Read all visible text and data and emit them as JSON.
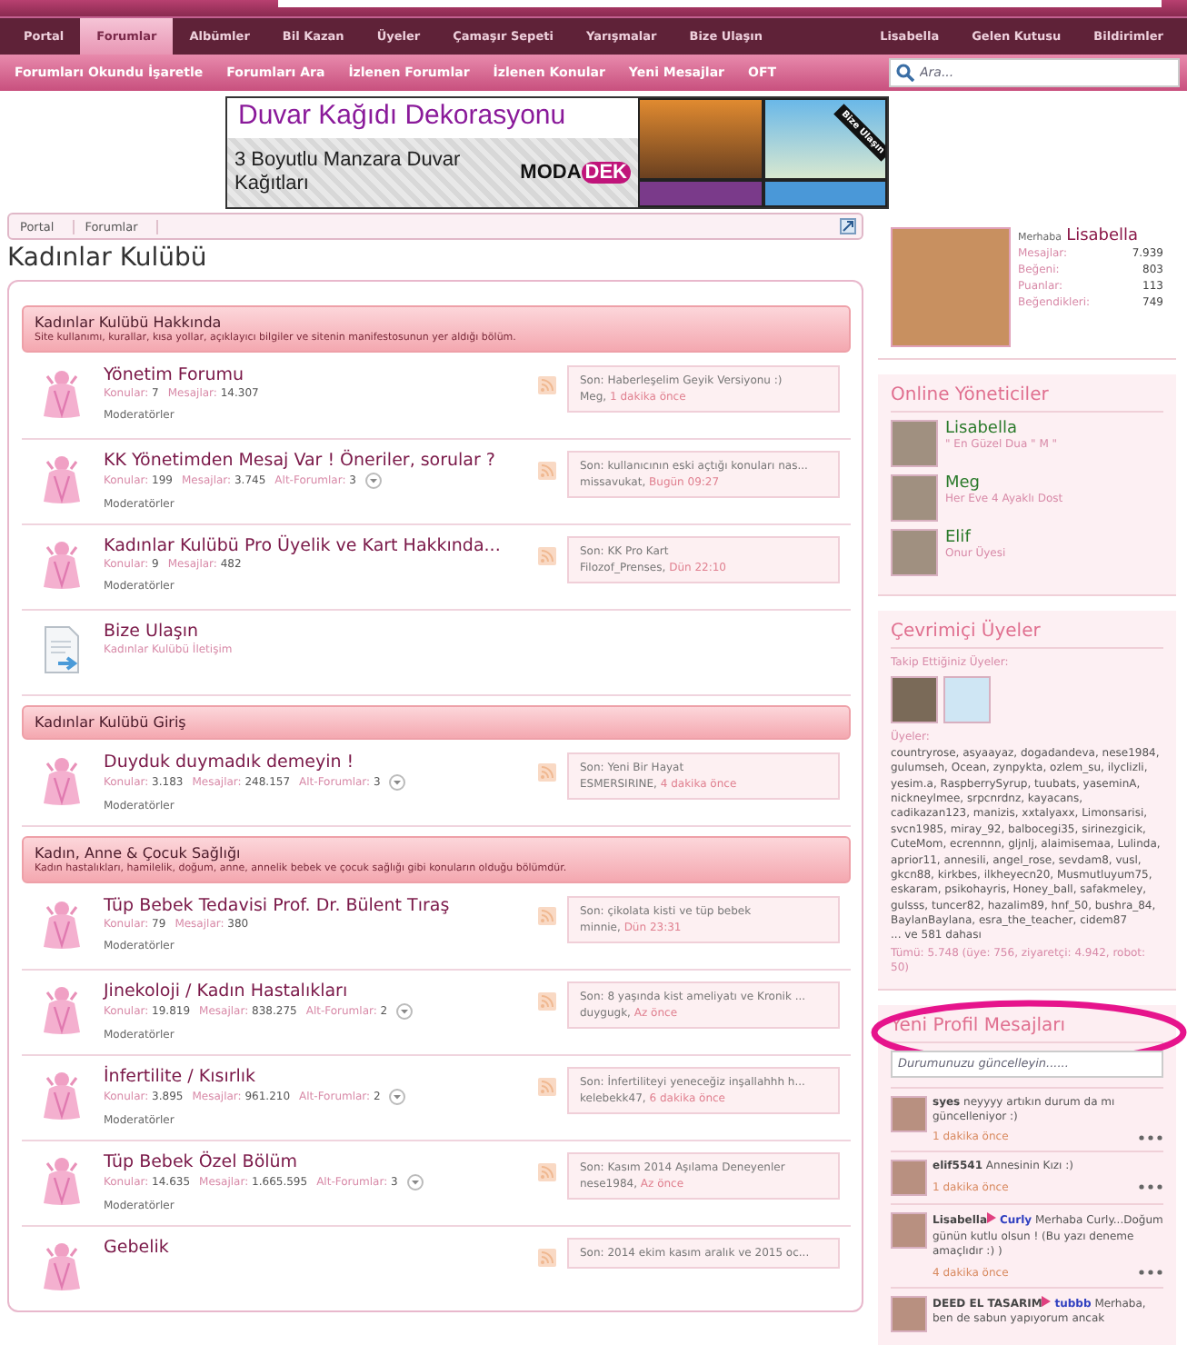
{
  "nav": {
    "tabs": [
      {
        "label": "Portal",
        "selected": false
      },
      {
        "label": "Forumlar",
        "selected": true
      },
      {
        "label": "Albümler",
        "selected": false
      },
      {
        "label": "Bil Kazan",
        "selected": false
      },
      {
        "label": "Üyeler",
        "selected": false
      },
      {
        "label": "Çamaşır Sepeti",
        "selected": false
      },
      {
        "label": "Yarışmalar",
        "selected": false
      },
      {
        "label": "Bize Ulaşın",
        "selected": false
      }
    ],
    "user_links": [
      "Lisabella",
      "Gelen Kutusu",
      "Bildirimler"
    ],
    "sub_links": [
      "Forumları Okundu İşaretle",
      "Forumları Ara",
      "İzlenen Forumlar",
      "İzlenen Konular",
      "Yeni Mesajlar",
      "OFT"
    ],
    "search": {
      "placeholder": "Ara..."
    }
  },
  "ad": {
    "headline": "Duvar Kağıdı Dekorasyonu",
    "text": "3 Boyutlu Manzara Duvar Kağıtları",
    "logo_left": "MODA",
    "logo_right": "DEK",
    "ribbon": "Bize Ulaşın"
  },
  "breadcrumb": [
    "Portal",
    "Forumlar"
  ],
  "page_title": "Kadınlar Kulübü",
  "categories": [
    {
      "title": "Kadınlar Kulübü Hakkında",
      "description": "Site kullanımı, kurallar, kısa yollar, açıklayıcı bilgiler ve sitenin manifestosunun yer aldığı bölüm.",
      "forums": [
        {
          "kind": "forum",
          "title": "Yönetim Forumu",
          "topics_label": "Konular:",
          "topics": "7",
          "posts_label": "Mesajlar:",
          "posts": "14.307",
          "moderators": "Moderatörler",
          "last_title": "Son: Haberleşelim Geyik Versiyonu :)",
          "last_user": "Meg,",
          "last_time": "1 dakika önce"
        },
        {
          "kind": "forum",
          "title": "KK Yönetimden Mesaj Var ! Öneriler, sorular ?",
          "topics_label": "Konular:",
          "topics": "199",
          "posts_label": "Mesajlar:",
          "posts": "3.745",
          "sub_label": "Alt-Forumlar:",
          "subforums": "3",
          "moderators": "Moderatörler",
          "last_title": "Son: kullanıcının eski açtığı konuları nas...",
          "last_user": "missavukat,",
          "last_time": "Bugün 09:27"
        },
        {
          "kind": "forum",
          "title": "Kadınlar Kulübü Pro Üyelik ve Kart Hakkında...",
          "topics_label": "Konular:",
          "topics": "9",
          "posts_label": "Mesajlar:",
          "posts": "482",
          "moderators": "Moderatörler",
          "last_title": "Son: KK Pro Kart",
          "last_user": "Filozof_Prenses,",
          "last_time": "Dün 22:10"
        },
        {
          "kind": "link",
          "title": "Bize Ulaşın",
          "description": "Kadınlar Kulübü İletişim"
        }
      ]
    },
    {
      "title": "Kadınlar Kulübü Giriş",
      "forums": [
        {
          "kind": "forum",
          "title": "Duyduk duymadık demeyin !",
          "topics_label": "Konular:",
          "topics": "3.183",
          "posts_label": "Mesajlar:",
          "posts": "248.157",
          "sub_label": "Alt-Forumlar:",
          "subforums": "3",
          "moderators": "Moderatörler",
          "last_title": "Son: Yeni Bir Hayat",
          "last_user": "ESMERSIRINE,",
          "last_time": "4 dakika önce"
        }
      ]
    },
    {
      "title": "Kadın, Anne & Çocuk Sağlığı",
      "description": "Kadın hastalıkları, hamilelik, doğum, anne, annelik bebek ve çocuk sağlığı gibi konuların olduğu bölümdür.",
      "forums": [
        {
          "kind": "forum",
          "title": "Tüp Bebek Tedavisi Prof. Dr. Bülent Tıraş",
          "topics_label": "Konular:",
          "topics": "79",
          "posts_label": "Mesajlar:",
          "posts": "380",
          "moderators": "Moderatörler",
          "last_title": "Son: çikolata kisti ve tüp bebek",
          "last_user": "minnie,",
          "last_time": "Dün 23:31"
        },
        {
          "kind": "forum",
          "title": "Jinekoloji / Kadın Hastalıkları",
          "topics_label": "Konular:",
          "topics": "19.819",
          "posts_label": "Mesajlar:",
          "posts": "838.275",
          "sub_label": "Alt-Forumlar:",
          "subforums": "2",
          "moderators": "Moderatörler",
          "last_title": "Son: 8 yaşında kist ameliyatı ve Kronik ...",
          "last_user": "duygugk,",
          "last_time": "Az önce"
        },
        {
          "kind": "forum",
          "title": "İnfertilite / Kısırlık",
          "topics_label": "Konular:",
          "topics": "3.895",
          "posts_label": "Mesajlar:",
          "posts": "961.210",
          "sub_label": "Alt-Forumlar:",
          "subforums": "2",
          "moderators": "Moderatörler",
          "last_title": "Son: İnfertiliteyi yeneceğiz inşallahhh h...",
          "last_user": "kelebekk47,",
          "last_time": "6 dakika önce"
        },
        {
          "kind": "forum",
          "title": "Tüp Bebek Özel Bölüm",
          "topics_label": "Konular:",
          "topics": "14.635",
          "posts_label": "Mesajlar:",
          "posts": "1.665.595",
          "sub_label": "Alt-Forumlar:",
          "subforums": "3",
          "moderators": "Moderatörler",
          "last_title": "Son: Kasım 2014 Aşılama Deneyenler",
          "last_user": "nese1984,",
          "last_time": "Az önce"
        },
        {
          "kind": "forum",
          "title": "Gebelik",
          "last_title": "Son: 2014 ekim kasım aralık ve 2015 oc..."
        }
      ]
    }
  ],
  "profile": {
    "greeting": "Merhaba",
    "name": "Lisabella",
    "stats": [
      {
        "label": "Mesajlar:",
        "value": "7.939"
      },
      {
        "label": "Beğeni:",
        "value": "803"
      },
      {
        "label": "Puanlar:",
        "value": "113"
      },
      {
        "label": "Beğendikleri:",
        "value": "749"
      }
    ]
  },
  "online_staff": {
    "title": "Online Yöneticiler",
    "members": [
      {
        "name": "Lisabella",
        "title": "\" En Güzel Dua \" M \""
      },
      {
        "name": "Meg",
        "title": "Her Eve 4 Ayaklı Dost"
      },
      {
        "name": "Elif",
        "title": "Onur Üyesi"
      }
    ]
  },
  "online_members": {
    "title": "Çevrimiçi Üyeler",
    "following_label": "Takip Ettiğiniz Üyeler:",
    "following": [
      {
        "kind": "photo"
      },
      {
        "kind": "cartoon"
      }
    ],
    "members_label": "Üyeler:",
    "members": "countryrose, asyaayaz, dogadandeva, nese1984, gulumseh, Ocean, zynpykta, ozlem_su, ilyclizli, yesim.a, RaspberrySyrup, tuubats, yaseminA, nickneylmee, srpcnrdnz, kayacans, cadikazan123, manizis, xxtalyaxx, Limonsarisi, svcn1985, miray_92, balbocegi35, sirinezgicik, CuteMom, ecrennnn, gljnlj, alaimisemaa, Lulinda, aprior11, annesili, angel_rose, sevdam8, vusl, gkcn88, kirkbes, ilkheyecn20, Musmutluyum75, eskaram, psikohayris, Honey_ball, safakmeley, gulsss, tuncer82, hazalim89, hnf_50, bushra_84, BaylanBaylana, esra_the_teacher, cidem87",
    "more": "... ve 581 dahası",
    "totals": "Tümü: 5.748 (üye: 756, ziyaretçi: 4.942, robot: 50)"
  },
  "profile_posts": {
    "title": "Yeni Profil Mesajları",
    "highlighted": true,
    "status_placeholder": "Durumunuzu güncelleyin......",
    "posts": [
      {
        "author": "syes",
        "text": "neyyyy artıkın durum da mı güncelleniyor :)",
        "time": "1 dakika önce"
      },
      {
        "author": "elif5541",
        "text": "Annesinin Kızı :)",
        "time": "1 dakika önce"
      },
      {
        "author": "Lisabella",
        "recipient": "Curly",
        "text": "Merhaba Curly...Doğum günün kutlu olsun ! (Bu yazı deneme amaçlıdır :) )",
        "time": "4 dakika önce"
      },
      {
        "author": "DEED EL TASARIM",
        "recipient": "tubbb",
        "text": "Merhaba, ben de sabun yapıyorum ancak"
      }
    ]
  }
}
